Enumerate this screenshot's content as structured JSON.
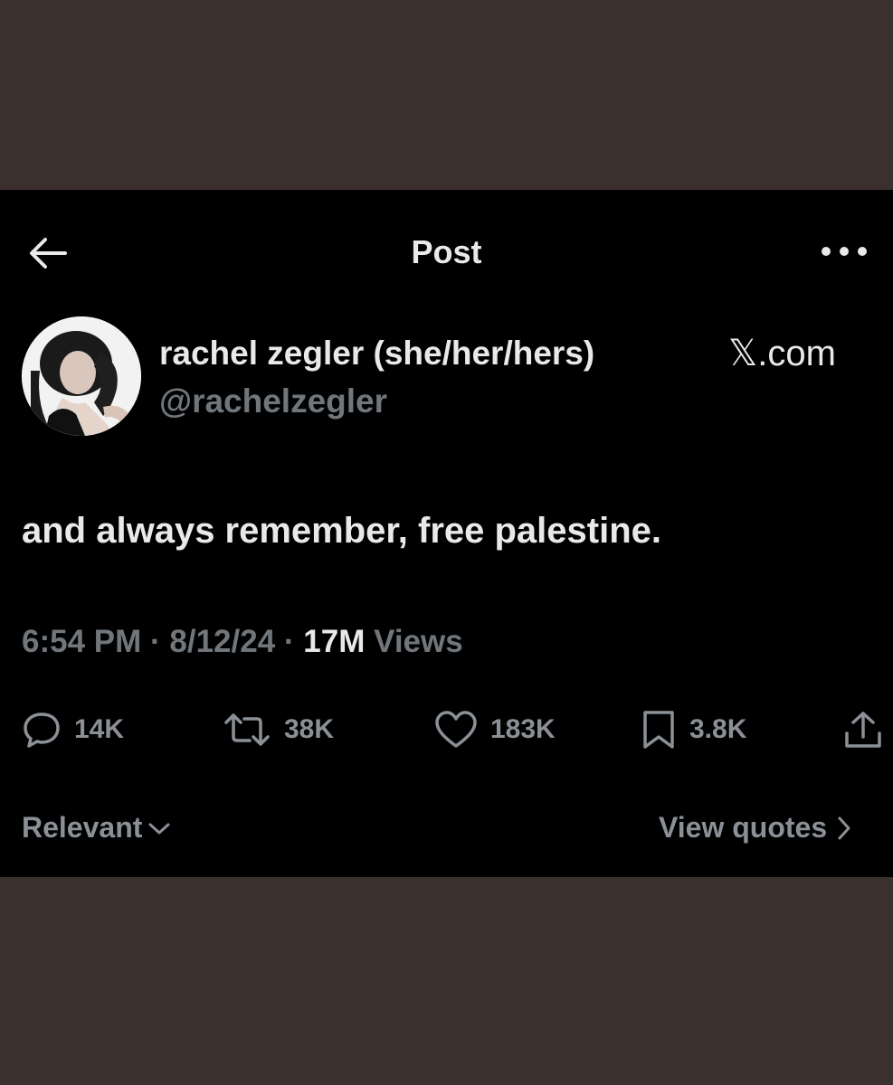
{
  "header": {
    "back_icon": "arrow-left-icon",
    "title": "Post",
    "more_icon": "more-horizontal-icon"
  },
  "author": {
    "avatar": "profile-photo",
    "display_name": "rachel zegler (she/her/hers)",
    "handle": "@rachelzegler",
    "source": "𝕏.com"
  },
  "post": {
    "text": "and always remember, free palestine.",
    "time": "6:54 PM",
    "date": "8/12/24",
    "views_count": "17M",
    "views_label": "Views",
    "separator": " · "
  },
  "actions": {
    "reply": {
      "icon": "reply-icon",
      "count": "14K"
    },
    "repost": {
      "icon": "repost-icon",
      "count": "38K"
    },
    "like": {
      "icon": "heart-icon",
      "count": "183K"
    },
    "bookmark": {
      "icon": "bookmark-icon",
      "count": "3.8K"
    },
    "share": {
      "icon": "share-icon"
    }
  },
  "footer": {
    "sort_label": "Relevant",
    "quotes_label": "View quotes"
  },
  "colors": {
    "frame_background": "#3c302f",
    "screen_background": "#000000",
    "primary_text": "#e7e9ea",
    "secondary_text": "#71767b"
  }
}
